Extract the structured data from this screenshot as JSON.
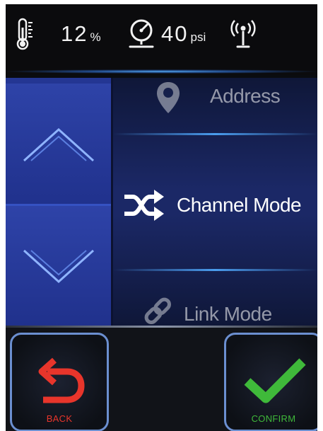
{
  "status_bar": {
    "humidity": {
      "value": "12",
      "unit": "%"
    },
    "pressure": {
      "value": "40",
      "unit": "psi"
    },
    "icons": [
      "thermometer-icon",
      "pressure-gauge-icon",
      "antenna-signal-icon"
    ]
  },
  "menu": {
    "items": [
      {
        "label": "Address",
        "icon": "location-pin-icon",
        "state": "previous"
      },
      {
        "label": "Channel Mode",
        "icon": "shuffle-icon",
        "state": "selected"
      },
      {
        "label": "Link Mode",
        "icon": "link-icon",
        "state": "next"
      }
    ],
    "scroll_up_icon": "chevron-up-icon",
    "scroll_down_icon": "chevron-down-icon"
  },
  "actions": {
    "back": {
      "label": "BACK",
      "icon": "undo-arrow-icon",
      "color": "#e8352b"
    },
    "confirm": {
      "label": "CONFIRM",
      "icon": "checkmark-icon",
      "color": "#3fb93a"
    }
  },
  "colors": {
    "accent": "#2e43a8",
    "glow": "#5ab4ff",
    "button_border": "#6b8fd0"
  }
}
